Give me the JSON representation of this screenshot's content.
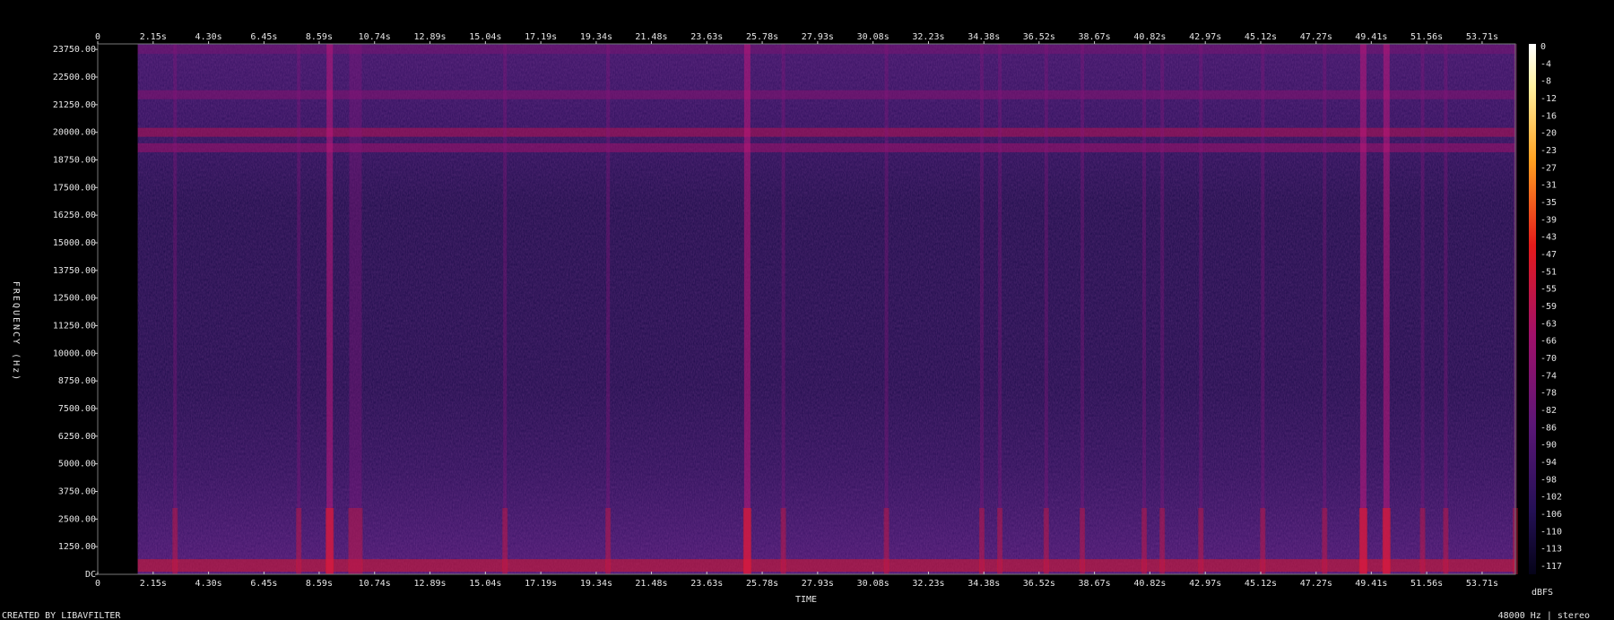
{
  "chart_data": {
    "type": "heatmap",
    "title": "",
    "xlabel": "TIME",
    "ylabel": "FREQUENCY (Hz)",
    "x_ticks": [
      "0",
      "2.15s",
      "4.30s",
      "6.45s",
      "8.59s",
      "10.74s",
      "12.89s",
      "15.04s",
      "17.19s",
      "19.34s",
      "21.48s",
      "23.63s",
      "25.78s",
      "27.93s",
      "30.08s",
      "32.23s",
      "34.38s",
      "36.52s",
      "38.67s",
      "40.82s",
      "42.97s",
      "45.12s",
      "47.27s",
      "49.41s",
      "51.56s",
      "53.71s"
    ],
    "x_tick_values": [
      0,
      2.15,
      4.3,
      6.45,
      8.59,
      10.74,
      12.89,
      15.04,
      17.19,
      19.34,
      21.48,
      23.63,
      25.78,
      27.93,
      30.08,
      32.23,
      34.38,
      36.52,
      38.67,
      40.82,
      42.97,
      45.12,
      47.27,
      49.41,
      51.56,
      53.71
    ],
    "xlim": [
      0,
      55.0
    ],
    "y_ticks": [
      "DC",
      "1250.00",
      "2500.00",
      "3750.00",
      "5000.00",
      "6250.00",
      "7500.00",
      "8750.00",
      "10000.00",
      "11250.00",
      "12500.00",
      "13750.00",
      "15000.00",
      "16250.00",
      "17500.00",
      "18750.00",
      "20000.00",
      "21250.00",
      "22500.00",
      "23750.00"
    ],
    "y_tick_values": [
      0,
      1250,
      2500,
      3750,
      5000,
      6250,
      7500,
      8750,
      10000,
      11250,
      12500,
      13750,
      15000,
      16250,
      17500,
      18750,
      20000,
      21250,
      22500,
      23750
    ],
    "ylim": [
      0,
      24000
    ],
    "colorbar": {
      "label": "dBFS",
      "ticks": [
        "0",
        "-4",
        "-8",
        "-12",
        "-16",
        "-20",
        "-23",
        "-27",
        "-31",
        "-35",
        "-39",
        "-43",
        "-47",
        "-51",
        "-55",
        "-59",
        "-63",
        "-66",
        "-70",
        "-74",
        "-78",
        "-82",
        "-86",
        "-90",
        "-94",
        "-98",
        "-102",
        "-106",
        "-110",
        "-113",
        "-117"
      ],
      "range": [
        0,
        -120
      ]
    },
    "bands": [
      {
        "freq_hz": 20000,
        "level_dbfs": -60
      },
      {
        "freq_hz": 19300,
        "level_dbfs": -66
      },
      {
        "freq_hz": 21700,
        "level_dbfs": -74
      },
      {
        "freq_hz": 23750,
        "level_dbfs": -78
      },
      {
        "freq_hz": 400,
        "level_dbfs": -50
      }
    ],
    "events_seconds": [
      3.0,
      7.8,
      9.0,
      10.0,
      15.8,
      19.8,
      25.2,
      26.6,
      30.6,
      34.3,
      35.0,
      36.8,
      38.2,
      40.6,
      41.3,
      42.8,
      45.2,
      47.6,
      49.1,
      50.0,
      51.4,
      52.3,
      55.0
    ]
  },
  "footer": {
    "left": "CREATED BY LIBAVFILTER",
    "right": "48000 Hz | stereo"
  },
  "colors": {
    "background": "#000000",
    "low": "#0b0730",
    "mid": "#5a1a78",
    "high": "#e01818",
    "peak": "#ffd040"
  }
}
